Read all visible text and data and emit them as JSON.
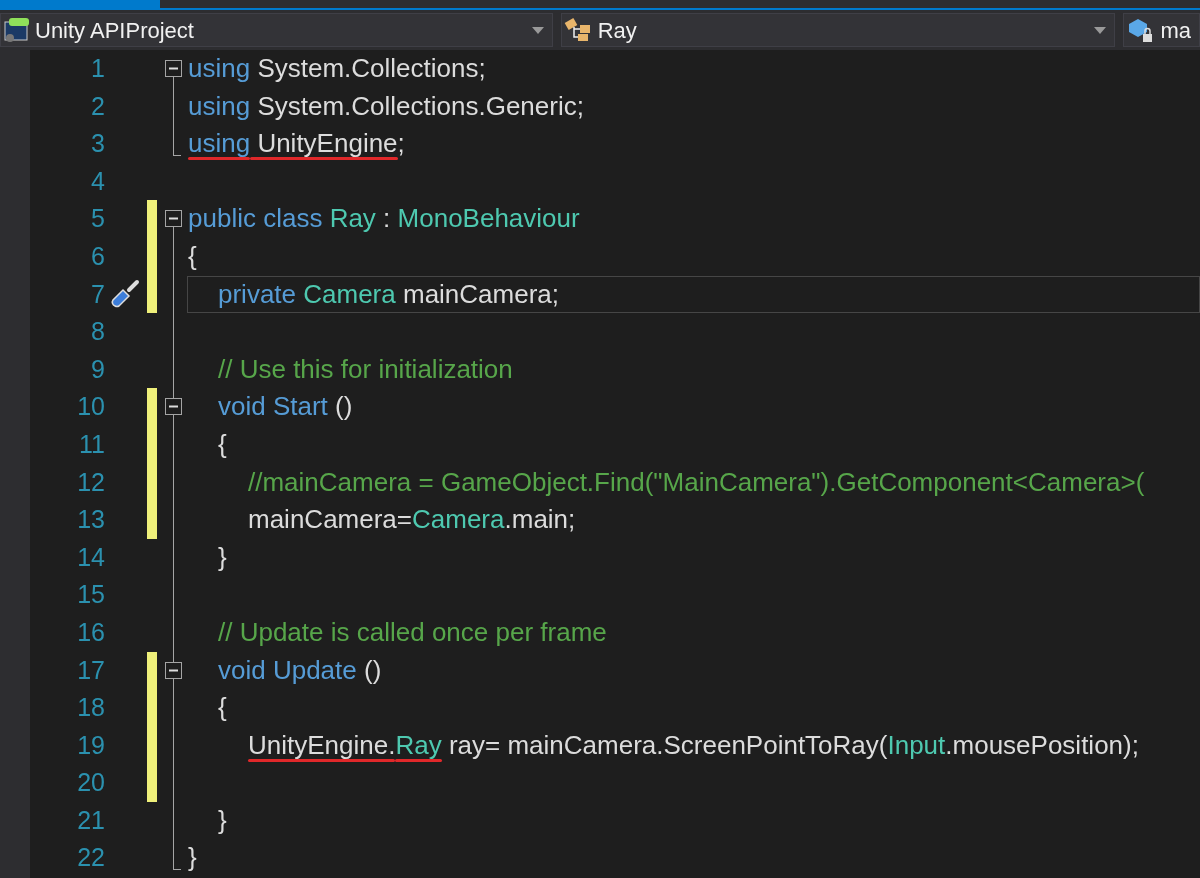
{
  "navigation_bar": {
    "dropdowns": [
      {
        "kind": "project",
        "text": "Unity APIProject",
        "caret": true
      },
      {
        "kind": "class",
        "text": "Ray",
        "caret": true
      },
      {
        "kind": "member",
        "text": "ma",
        "caret": false
      }
    ]
  },
  "editor": {
    "lines": [
      {
        "number": "1",
        "changed": false,
        "current": false,
        "quick_action": false,
        "collapsible": true,
        "tokens": [
          {
            "kind": "keyword",
            "text": "using ",
            "underlined": false
          },
          {
            "kind": "plain",
            "text": "System.Collections;",
            "underlined": false
          }
        ]
      },
      {
        "number": "2",
        "changed": false,
        "current": false,
        "quick_action": false,
        "collapsible": false,
        "tokens": [
          {
            "kind": "keyword",
            "text": "using ",
            "underlined": false
          },
          {
            "kind": "plain",
            "text": "System.Collections.Generic;",
            "underlined": false
          }
        ]
      },
      {
        "number": "3",
        "changed": false,
        "current": false,
        "quick_action": false,
        "collapsible": false,
        "tokens": [
          {
            "kind": "keyword",
            "text": "using",
            "underlined": true
          },
          {
            "kind": "plain",
            "text": " UnityEngine",
            "underlined": true
          },
          {
            "kind": "plain",
            "text": ";",
            "underlined": false
          }
        ]
      },
      {
        "number": "4",
        "changed": false,
        "current": false,
        "quick_action": false,
        "collapsible": false
      },
      {
        "number": "5",
        "changed": true,
        "current": false,
        "quick_action": false,
        "collapsible": true,
        "tokens": [
          {
            "kind": "keyword",
            "text": "public class ",
            "underlined": false
          },
          {
            "kind": "type",
            "text": "Ray",
            "underlined": false
          },
          {
            "kind": "plain",
            "text": " : ",
            "underlined": false
          },
          {
            "kind": "type",
            "text": "MonoBehaviour",
            "underlined": false
          }
        ]
      },
      {
        "number": "6",
        "changed": true,
        "current": false,
        "quick_action": false,
        "collapsible": false,
        "tokens": [
          {
            "kind": "plain",
            "text": "{",
            "underlined": false
          }
        ],
        "children": [
          {
            "number": "7",
            "changed": true,
            "current": true,
            "quick_action": true,
            "collapsible": false,
            "tokens": [
              {
                "kind": "keyword",
                "text": "private ",
                "underlined": false
              },
              {
                "kind": "type",
                "text": "Camera",
                "underlined": false
              },
              {
                "kind": "plain",
                "text": " mainCamera;",
                "underlined": false
              }
            ]
          },
          {
            "number": "8",
            "changed": false,
            "current": false,
            "quick_action": false,
            "collapsible": false
          },
          {
            "number": "9",
            "changed": false,
            "current": false,
            "quick_action": false,
            "collapsible": false,
            "tokens": [
              {
                "kind": "comment",
                "text": "// Use this for initialization",
                "underlined": false
              }
            ]
          },
          {
            "number": "10",
            "changed": true,
            "current": false,
            "quick_action": false,
            "collapsible": true,
            "tokens": [
              {
                "kind": "keyword",
                "text": "void Start",
                "underlined": false
              },
              {
                "kind": "plain",
                "text": " ()",
                "underlined": false
              }
            ]
          },
          {
            "number": "11",
            "changed": true,
            "current": false,
            "quick_action": false,
            "collapsible": false,
            "tokens": [
              {
                "kind": "plain",
                "text": "{",
                "underlined": false
              }
            ],
            "children": [
              {
                "number": "12",
                "changed": true,
                "current": false,
                "quick_action": false,
                "collapsible": false,
                "tokens": [
                  {
                    "kind": "comment",
                    "text": "//mainCamera = GameObject.Find(\"MainCamera\").GetComponent<Camera>(",
                    "underlined": false
                  }
                ]
              },
              {
                "number": "13",
                "changed": true,
                "current": false,
                "quick_action": false,
                "collapsible": false,
                "tokens": [
                  {
                    "kind": "plain",
                    "text": "mainCamera=",
                    "underlined": false
                  },
                  {
                    "kind": "type",
                    "text": "Camera",
                    "underlined": false
                  },
                  {
                    "kind": "plain",
                    "text": ".main;",
                    "underlined": false
                  }
                ]
              }
            ]
          },
          {
            "number": "14",
            "changed": false,
            "current": false,
            "quick_action": false,
            "collapsible": false,
            "tokens": [
              {
                "kind": "plain",
                "text": "}",
                "underlined": false
              }
            ]
          },
          {
            "number": "15",
            "changed": false,
            "current": false,
            "quick_action": false,
            "collapsible": false
          },
          {
            "number": "16",
            "changed": false,
            "current": false,
            "quick_action": false,
            "collapsible": false,
            "tokens": [
              {
                "kind": "comment",
                "text": "// Update is called once per frame",
                "underlined": false
              }
            ]
          },
          {
            "number": "17",
            "changed": true,
            "current": false,
            "quick_action": false,
            "collapsible": true,
            "tokens": [
              {
                "kind": "keyword",
                "text": "void Update",
                "underlined": false
              },
              {
                "kind": "plain",
                "text": " ()",
                "underlined": false
              }
            ]
          },
          {
            "number": "18",
            "changed": true,
            "current": false,
            "quick_action": false,
            "collapsible": false,
            "tokens": [
              {
                "kind": "plain",
                "text": "{",
                "underlined": false
              }
            ],
            "children": [
              {
                "number": "19",
                "changed": true,
                "current": false,
                "quick_action": false,
                "collapsible": false,
                "tokens": [
                  {
                    "kind": "plain",
                    "text": "UnityEngine.",
                    "underlined": true
                  },
                  {
                    "kind": "type",
                    "text": "Ray",
                    "underlined": true
                  },
                  {
                    "kind": "plain",
                    "text": " ray= mainCamera.ScreenPointToRay(",
                    "underlined": false
                  },
                  {
                    "kind": "type",
                    "text": "Input",
                    "underlined": false
                  },
                  {
                    "kind": "plain",
                    "text": ".mousePosition);",
                    "underlined": false
                  }
                ]
              },
              {
                "number": "20",
                "changed": true,
                "current": false,
                "quick_action": false,
                "collapsible": false
              }
            ]
          },
          {
            "number": "21",
            "changed": false,
            "current": false,
            "quick_action": false,
            "collapsible": false,
            "tokens": [
              {
                "kind": "plain",
                "text": "}",
                "underlined": false
              }
            ]
          }
        ]
      },
      {
        "number": "22",
        "changed": false,
        "current": false,
        "quick_action": false,
        "collapsible": false,
        "tokens": [
          {
            "kind": "plain",
            "text": "}",
            "underlined": false
          }
        ]
      }
    ]
  }
}
